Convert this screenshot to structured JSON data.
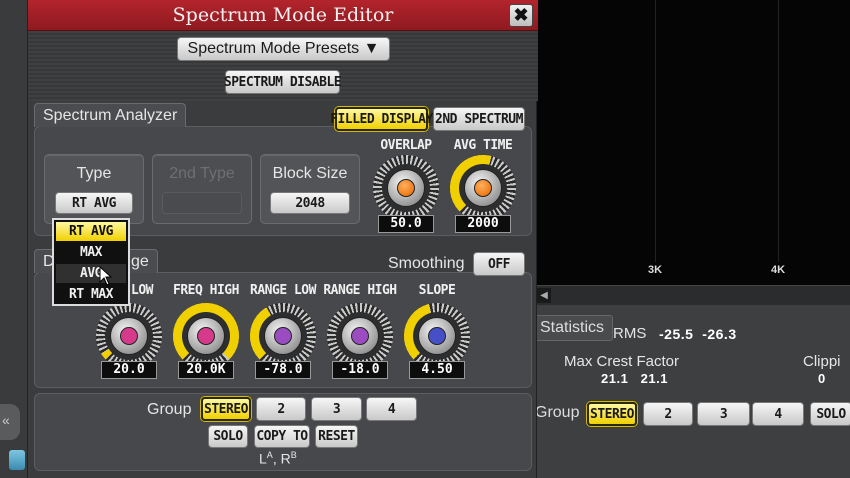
{
  "dialog": {
    "title": "Spectrum Mode Editor",
    "close_glyph": "✖",
    "presets_label": "Spectrum Mode Presets ▼",
    "disable_label": "SPECTRUM DISABLE"
  },
  "analyzer": {
    "tab_label": "Spectrum Analyzer",
    "filled_display": "FILLED DISPLAY",
    "second_spectrum": "2ND SPECTRUM",
    "type_title": "Type",
    "type_value": "RT AVG",
    "second_type_title": "2nd Type",
    "block_size_title": "Block Size",
    "block_size_value": "2048",
    "overlap_label": "OVERLAP",
    "overlap_value": "50.0",
    "avg_time_label": "AVG TIME",
    "avg_time_value": "2000"
  },
  "type_options": [
    "RT AVG",
    "MAX",
    "AVG",
    "RT MAX"
  ],
  "display": {
    "tab_left": "D",
    "tab_right": "ge",
    "smoothing_label": "Smoothing",
    "smoothing_value": "OFF",
    "knobs": [
      {
        "label": "LOW",
        "value": "20.0",
        "color": "#d53a8c"
      },
      {
        "label": "FREQ HIGH",
        "value": "20.0K",
        "color": "#d53a8c"
      },
      {
        "label": "RANGE LOW",
        "value": "-78.0",
        "color": "#9a4cc0"
      },
      {
        "label": "RANGE HIGH",
        "value": "-18.0",
        "color": "#9a4cc0"
      },
      {
        "label": "SLOPE",
        "value": "4.50",
        "color": "#4550c8"
      }
    ]
  },
  "group": {
    "label": "Group",
    "stereo": "STEREO",
    "g2": "2",
    "g3": "3",
    "g4": "4",
    "solo": "SOLO",
    "copy_to": "COPY TO",
    "reset": "RESET",
    "footer_base_a": "L",
    "footer_sup_a": "A",
    "footer_sep": ", R",
    "footer_sup_b": "B"
  },
  "background": {
    "freq_3k": "3K",
    "freq_4k": "4K",
    "stats_tab": "Statistics",
    "rms_label": "RMS",
    "rms_values": "-25.5  -26.3",
    "crest_label": "Max Crest Factor",
    "crest_values": "21.1   21.1",
    "clip_label": "Clippi",
    "clip_value": "0",
    "group_label": "Group",
    "stereo": "STEREO",
    "g2": "2",
    "g3": "3",
    "g4": "4",
    "solo": "SOLO",
    "chevron": "«"
  },
  "colors": {
    "title_red": "#a81f26",
    "accent_yellow": "#f0d000",
    "knob_orange": "#f07a14"
  }
}
